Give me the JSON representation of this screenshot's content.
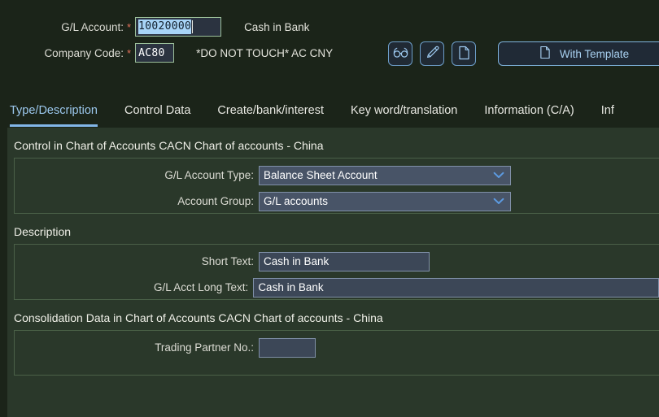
{
  "header": {
    "gl_account_label": "G/L Account:",
    "gl_account_value": "10020000",
    "gl_account_desc": "Cash in Bank",
    "company_code_label": "Company Code:",
    "company_code_value": "AC80",
    "company_code_desc": "*DO NOT TOUCH* AC CNY",
    "required_marker": "*"
  },
  "toolbar": {
    "display_icon": "glasses-icon",
    "edit_icon": "pencil-icon",
    "create_icon": "document-icon",
    "with_template_label": "With Template",
    "with_template_icon": "document-icon"
  },
  "tabs": [
    {
      "label": "Type/Description",
      "active": true
    },
    {
      "label": "Control Data",
      "active": false
    },
    {
      "label": "Create/bank/interest",
      "active": false
    },
    {
      "label": "Key word/translation",
      "active": false
    },
    {
      "label": "Information (C/A)",
      "active": false
    },
    {
      "label": "Inf",
      "active": false
    }
  ],
  "sections": [
    {
      "title": "Control in Chart of Accounts CACN Chart of accounts - China",
      "fields": [
        {
          "label": "G/L Account Type:",
          "value": "Balance Sheet Account",
          "type": "select"
        },
        {
          "label": "Account Group:",
          "value": "G/L accounts",
          "type": "select"
        }
      ]
    },
    {
      "title": "Description",
      "fields": [
        {
          "label": "Short Text:",
          "value": "Cash in Bank",
          "type": "text-short"
        },
        {
          "label": "G/L Acct Long Text:",
          "value": "Cash in Bank",
          "type": "text-long"
        }
      ]
    },
    {
      "title": "Consolidation Data in Chart of Accounts CACN Chart of accounts - China",
      "fields": [
        {
          "label": "Trading Partner No.:",
          "value": "",
          "type": "text-tiny"
        }
      ]
    }
  ],
  "colors": {
    "page_background": "#1b2419",
    "content_background": "#2a382a",
    "accent_blue": "#82b6e8",
    "input_background": "#3c4757",
    "select_background": "#485467",
    "key_input_background": "#2b3340",
    "key_input_border": "#9cc09a",
    "selection_highlight": "#a8d4f7",
    "required_star": "#e0705a",
    "panel_border": "#4a6047"
  }
}
